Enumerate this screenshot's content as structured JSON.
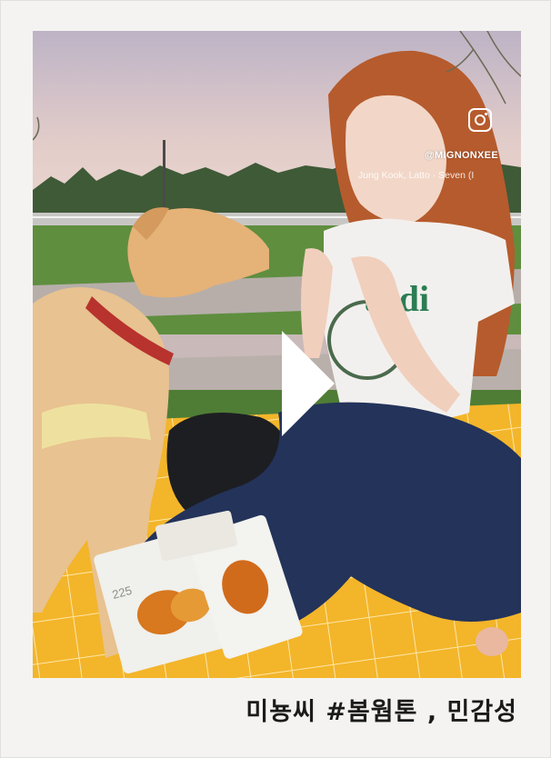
{
  "post": {
    "instagram_handle": "@MIGNONXEE",
    "music": "Jung Kook, Latto · Seven (I",
    "caption": "미뇽씨  #봄웜톤 , 민감성",
    "instagram_icon": "instagram-icon",
    "play_icon": "play-icon"
  },
  "packages": {
    "brand_text": "225"
  },
  "colors": {
    "frame": "#f4f3f1",
    "blanket": "#f3b52a",
    "jeans": "#23335a",
    "dog": "#e7c08a",
    "sky": "#d4c6cf"
  }
}
